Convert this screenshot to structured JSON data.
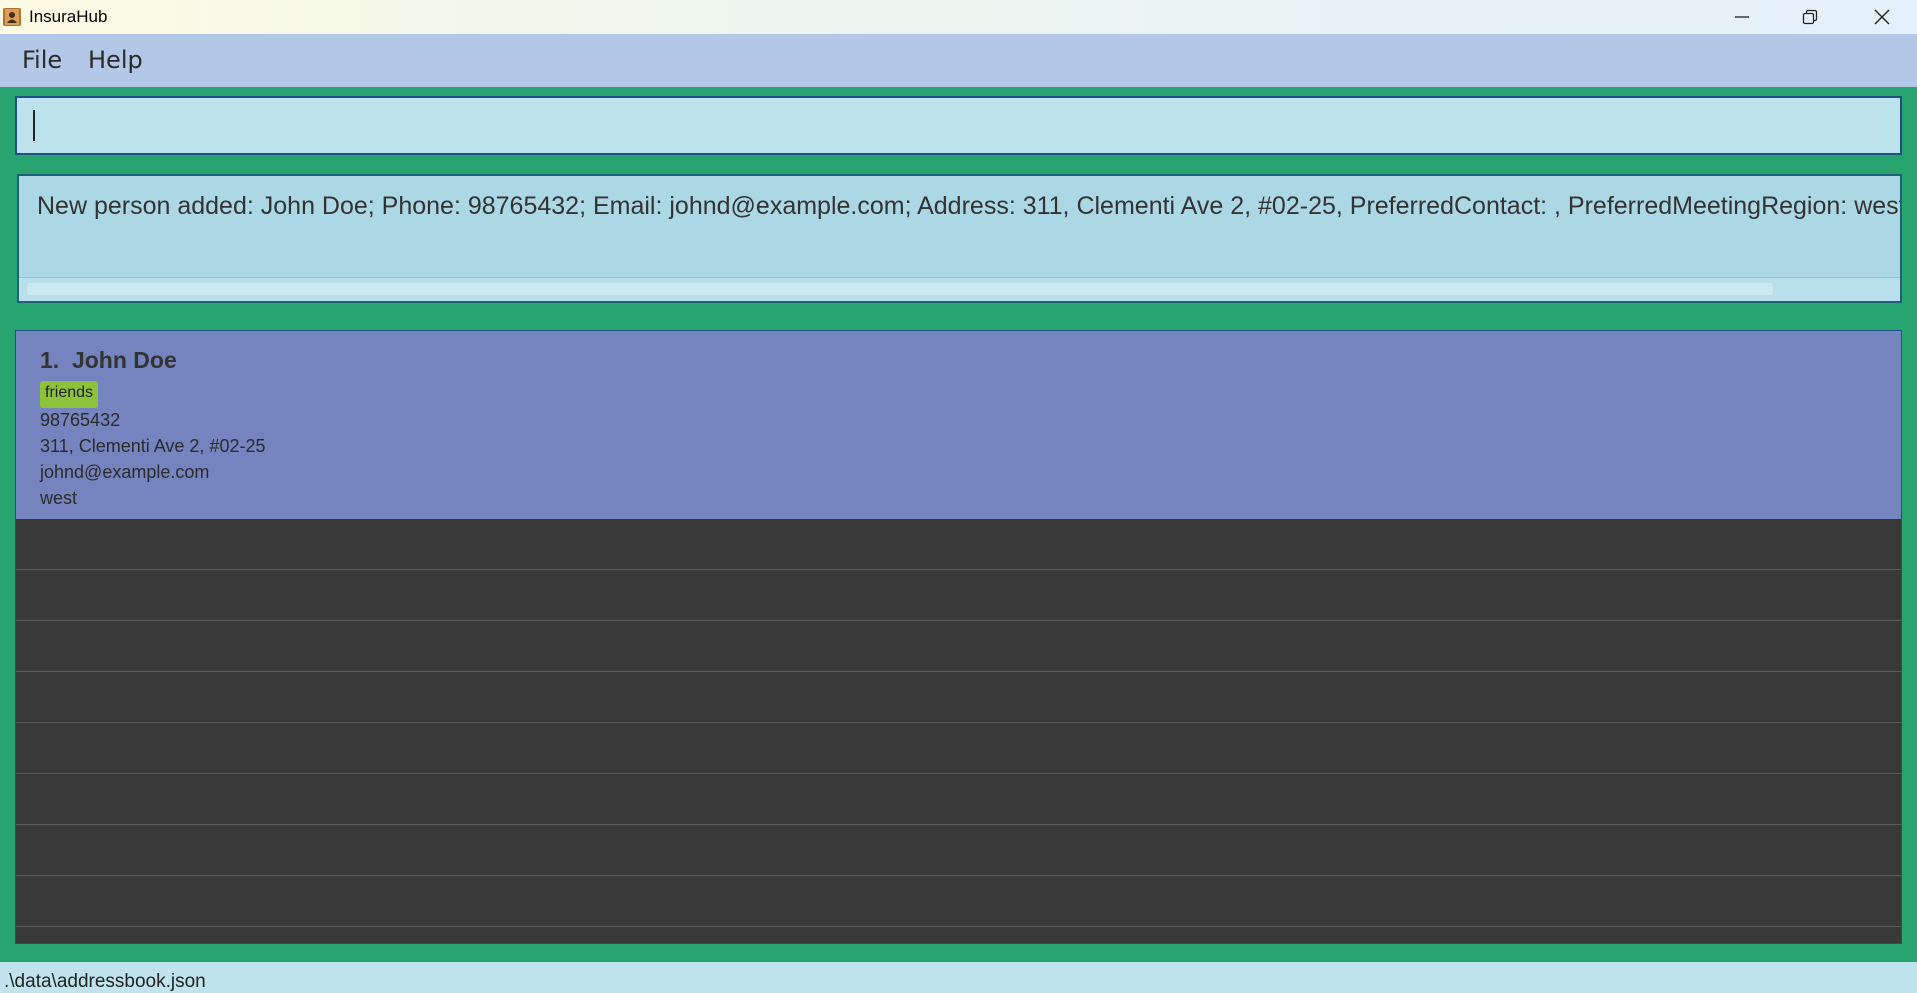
{
  "window": {
    "title": "InsuraHub",
    "icon": "contact-book-icon",
    "controls": [
      "minimize-icon",
      "restore-icon",
      "close-icon"
    ]
  },
  "menu": {
    "file": "File",
    "help": "Help"
  },
  "command_box": {
    "value": ""
  },
  "result": {
    "text": "New person added: John Doe; Phone: 98765432; Email: johnd@example.com; Address: 311, Clementi Ave 2, #02-25, PreferredContact: , PreferredMeetingRegion: west; Tags: [friends]"
  },
  "persons": [
    {
      "index": "1.",
      "name": "John Doe",
      "tags": [
        "friends"
      ],
      "phone": "98765432",
      "address": "311, Clementi Ave 2, #02-25",
      "email": "johnd@example.com",
      "region": "west"
    }
  ],
  "status": {
    "path": ".\\data\\addressbook.json"
  },
  "colors": {
    "background": "#27a46f",
    "menubar": "#b2c8e6",
    "command_box": "#bce3ec",
    "result_box": "#acd8e6",
    "card_selected": "#7583be",
    "list_background": "#383838",
    "tag": "#8dc23b"
  }
}
